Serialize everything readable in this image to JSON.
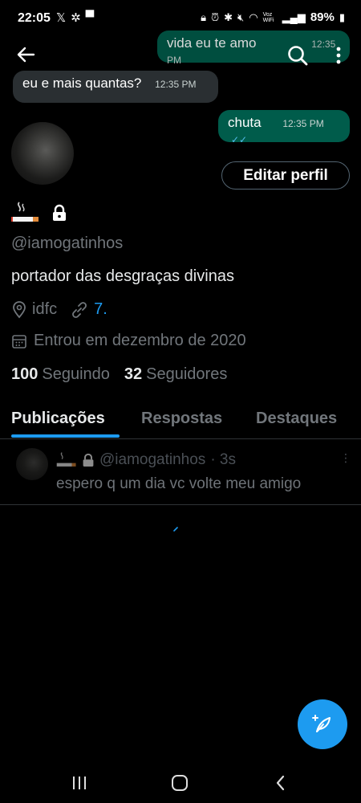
{
  "status_bar": {
    "time": "22:05",
    "battery": "89%",
    "network_label": "Voz WiFi"
  },
  "chat_overlay": {
    "messages": [
      {
        "text": "vida eu te amo",
        "time": "12:35 PM",
        "side": "right"
      },
      {
        "text": "eu e mais quantas?",
        "time": "12:35 PM",
        "side": "left"
      },
      {
        "text": "chuta",
        "time": "12:35 PM",
        "side": "right"
      }
    ]
  },
  "profile": {
    "edit_button_label": "Editar perfil",
    "handle": "@iamogatinhos",
    "bio": "portador das desgraças divinas",
    "location": "idfc",
    "link": "7.",
    "joined": "Entrou em dezembro de 2020",
    "following_count": "100",
    "following_label": "Seguindo",
    "followers_count": "32",
    "followers_label": "Seguidores"
  },
  "tabs": [
    {
      "label": "Publicações",
      "active": true
    },
    {
      "label": "Respostas",
      "active": false
    },
    {
      "label": "Destaques",
      "active": false
    }
  ],
  "post": {
    "handle": "@iamogatinhos",
    "time": "· 3s",
    "text": "espero q um dia vc volte meu amigo"
  },
  "colors": {
    "accent": "#1d9bf0",
    "chat_out": "#005c4b",
    "chat_in": "#2a2f32"
  }
}
